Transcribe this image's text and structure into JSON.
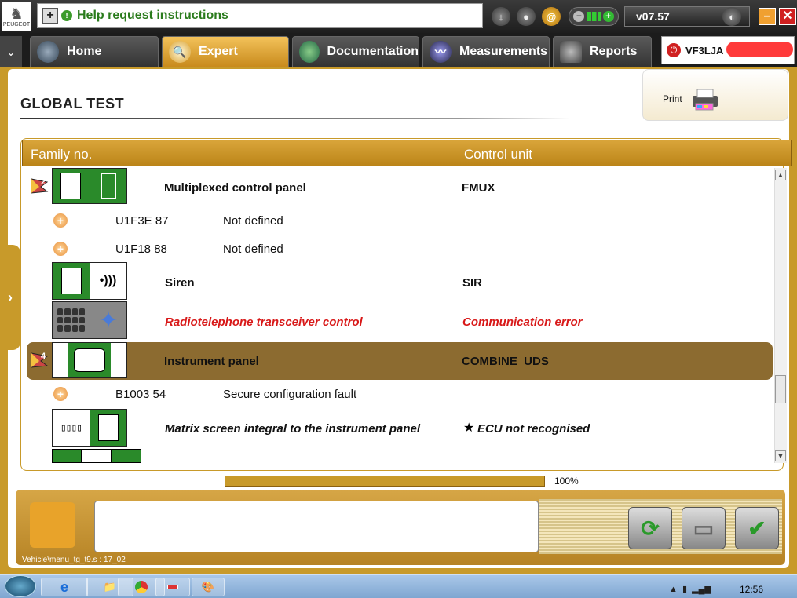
{
  "topbar": {
    "logo_text": "PEUGEOT",
    "help_text": "Help request instructions",
    "version": "v07.57"
  },
  "tabs": [
    {
      "label": "Home"
    },
    {
      "label": "Expert"
    },
    {
      "label": "Documentation"
    },
    {
      "label": "Measurements"
    },
    {
      "label": "Reports"
    }
  ],
  "vehicle": {
    "vin_prefix": "VF3LJA"
  },
  "page": {
    "title": "GLOBAL TEST",
    "print_label": "Print"
  },
  "table": {
    "col_family": "Family no.",
    "col_control": "Control unit",
    "rows": [
      {
        "name": "Multiplexed control panel",
        "unit": "FMUX"
      },
      {
        "code": "U1F3E 87",
        "desc": "Not defined"
      },
      {
        "code": "U1F18 88",
        "desc": "Not defined"
      },
      {
        "name": "Siren",
        "unit": "SIR"
      },
      {
        "name": "Radiotelephone transceiver control",
        "unit": "Communication error"
      },
      {
        "name": "Instrument panel",
        "unit": "COMBINE_UDS"
      },
      {
        "code": "B1003 54",
        "desc": "Secure configuration fault"
      },
      {
        "name": "Matrix screen integral to the instrument panel",
        "unit": "ECU not recognised"
      }
    ],
    "flag_1": "2",
    "flag_5": "4"
  },
  "progress": {
    "value": 100,
    "label": "100%"
  },
  "status_path": "Vehicle\\menu_tg_t9.s : 17_02",
  "taskbar": {
    "clock": "12:56"
  }
}
